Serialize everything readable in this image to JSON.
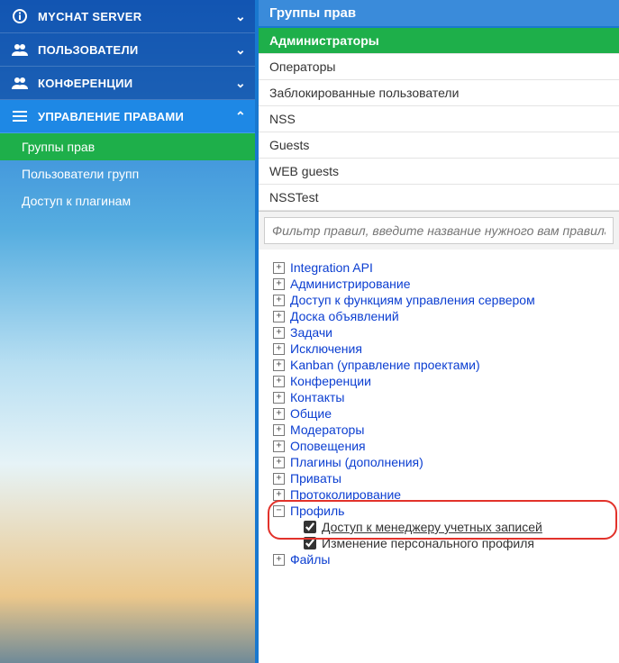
{
  "sidebar": {
    "sections": [
      {
        "icon": "info",
        "label": "MYCHAT SERVER",
        "expanded": false
      },
      {
        "icon": "users",
        "label": "ПОЛЬЗОВАТЕЛИ",
        "expanded": false
      },
      {
        "icon": "users",
        "label": "КОНФЕРЕНЦИИ",
        "expanded": false
      },
      {
        "icon": "list",
        "label": "УПРАВЛЕНИЕ ПРАВАМИ",
        "expanded": true,
        "active": true
      }
    ],
    "subitems": [
      {
        "label": "Группы прав",
        "selected": true
      },
      {
        "label": "Пользователи групп",
        "selected": false
      },
      {
        "label": "Доступ к плагинам",
        "selected": false
      }
    ]
  },
  "main": {
    "title": "Группы прав",
    "groups": [
      {
        "label": "Администраторы",
        "active": true
      },
      {
        "label": "Операторы"
      },
      {
        "label": "Заблокированные пользователи"
      },
      {
        "label": "NSS"
      },
      {
        "label": "Guests"
      },
      {
        "label": "WEB guests"
      },
      {
        "label": "NSSTest"
      }
    ],
    "filter_placeholder": "Фильтр правил, введите название нужного вам правила",
    "tree": [
      {
        "label": "Integration API"
      },
      {
        "label": "Администрирование"
      },
      {
        "label": "Доступ к функциям управления сервером"
      },
      {
        "label": "Доска объявлений"
      },
      {
        "label": "Задачи"
      },
      {
        "label": "Исключения"
      },
      {
        "label": "Kanban (управление проектами)"
      },
      {
        "label": "Конференции"
      },
      {
        "label": "Контакты"
      },
      {
        "label": "Общие"
      },
      {
        "label": "Модераторы"
      },
      {
        "label": "Оповещения"
      },
      {
        "label": "Плагины (дополнения)"
      },
      {
        "label": "Приваты"
      },
      {
        "label": "Протоколирование"
      },
      {
        "label": "Профиль",
        "expanded": true,
        "children": [
          {
            "label": "Доступ к менеджеру учетных записей",
            "checked": true,
            "highlight": true
          },
          {
            "label": "Изменение персонального профиля",
            "checked": true
          }
        ]
      },
      {
        "label": "Файлы"
      }
    ]
  }
}
